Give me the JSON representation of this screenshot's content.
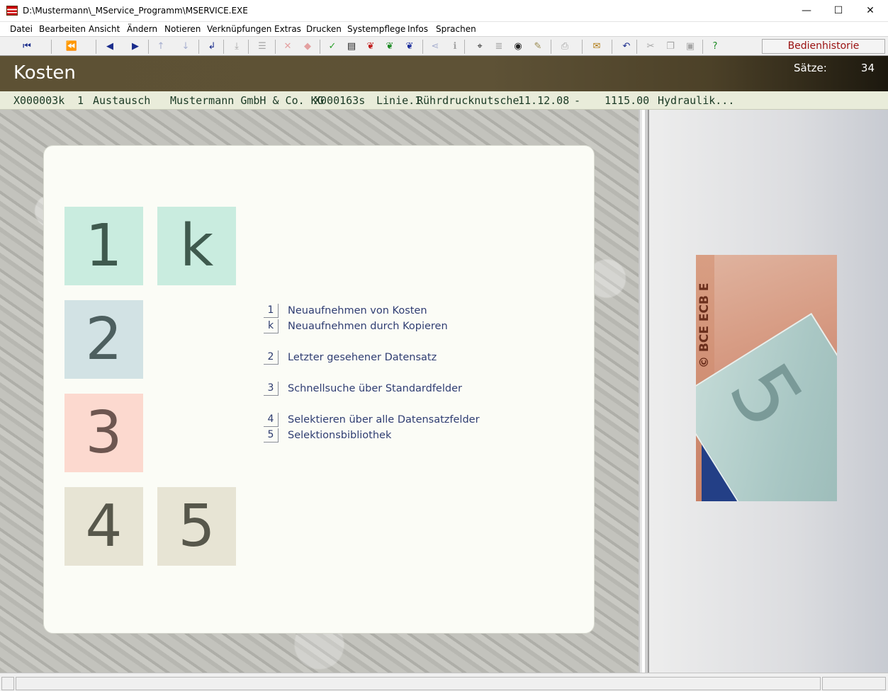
{
  "window": {
    "title": "D:\\Mustermann\\_MService_Programm\\MSERVICE.EXE",
    "minimize": "—",
    "maximize": "☐",
    "close": "✕"
  },
  "menu": [
    "Datei",
    "Bearbeiten",
    "Ansicht",
    "Ändern",
    "Notieren",
    "Verknüpfungen",
    "Extras",
    "Drucken",
    "Systempflege",
    "Infos",
    "Sprachen"
  ],
  "toolbar": {
    "history_label": "Bedienhistorie",
    "buttons": [
      {
        "icon": "first-record-icon",
        "glyph": "⏮",
        "color": "#1a2c8c"
      },
      {
        "icon": "rewind-icon",
        "glyph": "⏪",
        "color": "#1a2c8c"
      },
      {
        "icon": "previous-icon",
        "glyph": "◀",
        "color": "#1a2c8c"
      },
      {
        "icon": "next-icon",
        "glyph": "▶",
        "color": "#1a2c8c"
      },
      {
        "icon": "arrow-up-icon",
        "glyph": "↑",
        "color": "#a7afcf"
      },
      {
        "icon": "arrow-down-icon",
        "glyph": "↓",
        "color": "#a7afcf"
      },
      {
        "icon": "return-icon",
        "glyph": "↲",
        "color": "#1a2c8c"
      },
      {
        "icon": "import-icon",
        "glyph": "⤓",
        "color": "#a5a5a5"
      },
      {
        "icon": "list-icon",
        "glyph": "☰",
        "color": "#a5a5a5"
      },
      {
        "icon": "delete-icon",
        "glyph": "✕",
        "color": "#e3a0a0"
      },
      {
        "icon": "erase-icon",
        "glyph": "◆",
        "color": "#e3a0a0"
      },
      {
        "icon": "check-icon",
        "glyph": "✓",
        "color": "#2aa02a"
      },
      {
        "icon": "document-icon",
        "glyph": "▤",
        "color": "#222222"
      },
      {
        "icon": "record-red-icon",
        "glyph": "❦",
        "color": "#c01818"
      },
      {
        "icon": "record-green-icon",
        "glyph": "❦",
        "color": "#1a8a22"
      },
      {
        "icon": "record-blue-icon",
        "glyph": "❦",
        "color": "#1a2c9c"
      },
      {
        "icon": "link-icon",
        "glyph": "⋖",
        "color": "#a7afcf"
      },
      {
        "icon": "info-icon",
        "glyph": "ℹ",
        "color": "#a5a5a5"
      },
      {
        "icon": "binoculars-icon",
        "glyph": "⌖",
        "color": "#222222"
      },
      {
        "icon": "table-icon",
        "glyph": "≣",
        "color": "#a5a5a5"
      },
      {
        "icon": "eye-icon",
        "glyph": "◉",
        "color": "#222222"
      },
      {
        "icon": "highlight-icon",
        "glyph": "✎",
        "color": "#9a8a50"
      },
      {
        "icon": "print-icon",
        "glyph": "⎙",
        "color": "#a5a5a5"
      },
      {
        "icon": "mail-icon",
        "glyph": "✉",
        "color": "#b07a10"
      },
      {
        "icon": "undo-icon",
        "glyph": "↶",
        "color": "#1a2c8c"
      },
      {
        "icon": "cut-icon",
        "glyph": "✂",
        "color": "#a5a5a5"
      },
      {
        "icon": "copy-icon",
        "glyph": "❐",
        "color": "#a5a5a5"
      },
      {
        "icon": "paste-icon",
        "glyph": "▣",
        "color": "#a5a5a5"
      },
      {
        "icon": "help-icon",
        "glyph": "?",
        "color": "#1a8a22"
      }
    ]
  },
  "header": {
    "title": "Kosten",
    "count_label": "Sätze:",
    "count_value": "34"
  },
  "record": {
    "id": "X000003k",
    "number": "1",
    "type": "Austausch",
    "company": "Mustermann GmbH & Co. KG",
    "object_id": "X000163s",
    "line": "Linie.1",
    "device": "Rührdrucknutsche",
    "date": "11.12.08",
    "dash": "-",
    "amount": "1115.00",
    "category": "Hydraulik..."
  },
  "tiles": [
    {
      "key": "1",
      "color": "green"
    },
    {
      "key": "k",
      "color": "green"
    },
    {
      "key": "2",
      "color": "blue"
    },
    {
      "key": "3",
      "color": "red"
    },
    {
      "key": "4",
      "color": "beige"
    },
    {
      "key": "5",
      "color": "beige"
    }
  ],
  "options": [
    {
      "key": "1",
      "label": "Neuaufnehmen von Kosten"
    },
    {
      "key": "k",
      "label": "Neuaufnehmen durch Kopieren"
    },
    {
      "key": "2",
      "label": "Letzter gesehener Datensatz"
    },
    {
      "key": "3",
      "label": "Schnellsuche über Standardfelder"
    },
    {
      "key": "4",
      "label": "Selektieren über alle Datensatzfelder"
    },
    {
      "key": "5",
      "label": "Selektionsbibliothek"
    }
  ],
  "banknote": {
    "text": "© BCE ECB E"
  }
}
